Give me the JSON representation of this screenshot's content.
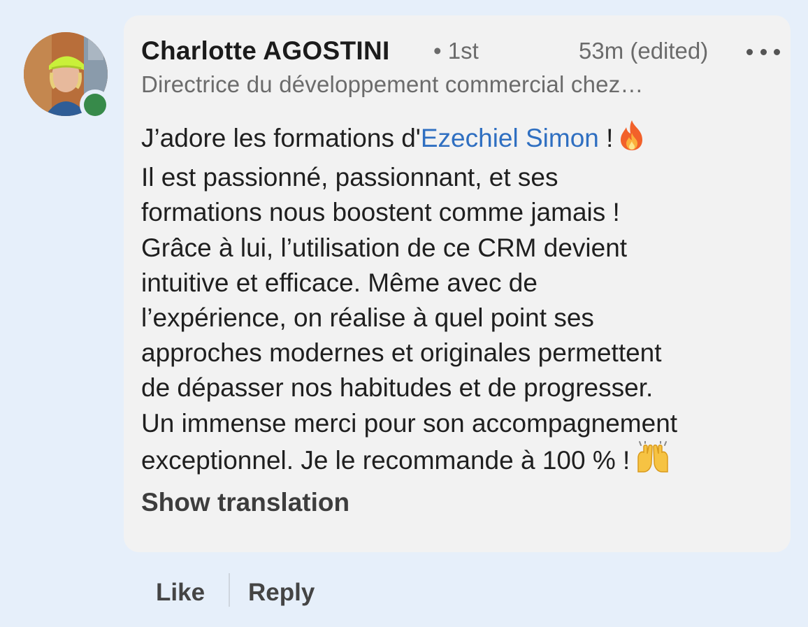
{
  "comment": {
    "author": "Charlotte AGOSTINI",
    "degree": "• 1st",
    "timestamp": "53m (edited)",
    "headline": "Directrice du développement commercial chez…",
    "lines": {
      "l1_before": "J’adore les formations d'",
      "l1_mention": "Ezechiel Simon",
      "l1_after": " !",
      "l2": "Il est passionné, passionnant, et ses",
      "l3": "formations nous boostent comme jamais !",
      "l4": "Grâce à lui, l’utilisation de ce CRM devient",
      "l5": "intuitive et efficace. Même avec de",
      "l6": "l’expérience, on réalise à quel point ses",
      "l7": "approches modernes et originales permettent",
      "l8": "de dépasser nos habitudes et de progresser.",
      "l9": "Un immense merci pour son accompagnement",
      "l10": "exceptionnel. Je le recommande à 100 % !"
    },
    "emojis": [
      "fire-emoji",
      "raising-hands-emoji"
    ],
    "show_translation": "Show translation"
  },
  "actions": {
    "like": "Like",
    "reply": "Reply"
  },
  "icons": {
    "more": "more-horizontal-icon",
    "presence": "online-status-dot"
  },
  "colors": {
    "background": "#e6effa",
    "bubble": "#f2f2f2",
    "mention": "#2f6fc1",
    "presence": "#378a4a"
  }
}
